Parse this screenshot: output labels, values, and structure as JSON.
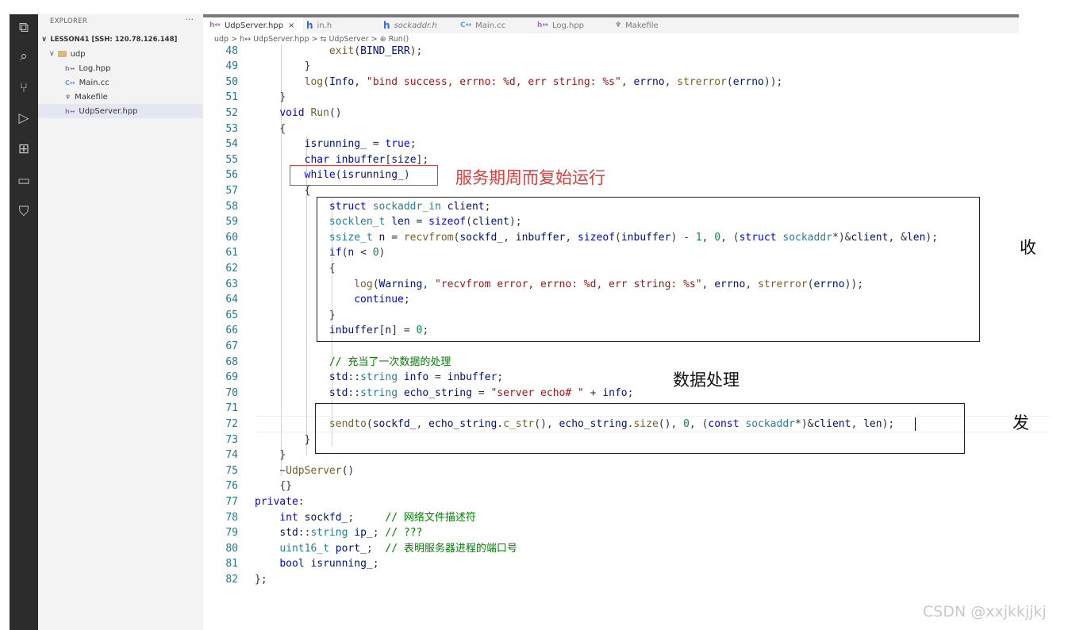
{
  "explorer": {
    "title": "EXPLORER",
    "more": "···",
    "root": "LESSON41 [SSH: 120.78.126.148]",
    "folder": "udp",
    "files": [
      "Log.hpp",
      "Main.cc",
      "Makefile",
      "UdpServer.hpp"
    ]
  },
  "tabs": [
    {
      "icon": "h↔",
      "label": "UdpServer.hpp",
      "close": "×"
    },
    {
      "icon": "h",
      "label": "in.h"
    },
    {
      "icon": "h",
      "label": "sockaddr.h"
    },
    {
      "icon": "C↔",
      "label": "Main.cc"
    },
    {
      "icon": "h↔",
      "label": "Log.hpp"
    },
    {
      "icon": "M",
      "label": "Makefile"
    }
  ],
  "breadcrumb": "udp > h↔ UdpServer.hpp > ⇆ UdpServer > ⊕ Run()",
  "lines": [
    {
      "n": "48",
      "code": "            exit(BIND_ERR);"
    },
    {
      "n": "49",
      "code": "        }"
    },
    {
      "n": "50",
      "code": "        log(Info, \"bind success, errno: %d, err string: %s\", errno, strerror(errno));"
    },
    {
      "n": "51",
      "code": "    }"
    },
    {
      "n": "52",
      "code": "    void Run()"
    },
    {
      "n": "53",
      "code": "    {"
    },
    {
      "n": "54",
      "code": "        isrunning_ = true;"
    },
    {
      "n": "55",
      "code": "        char inbuffer[size];"
    },
    {
      "n": "56",
      "code": "        while(isrunning_)"
    },
    {
      "n": "57",
      "code": "        {"
    },
    {
      "n": "58",
      "code": "            struct sockaddr_in client;"
    },
    {
      "n": "59",
      "code": "            socklen_t len = sizeof(client);"
    },
    {
      "n": "60",
      "code": "            ssize_t n = recvfrom(sockfd_, inbuffer, sizeof(inbuffer) - 1, 0, (struct sockaddr*)&client, &len);"
    },
    {
      "n": "61",
      "code": "            if(n < 0)"
    },
    {
      "n": "62",
      "code": "            {"
    },
    {
      "n": "63",
      "code": "                log(Warning, \"recvfrom error, errno: %d, err string: %s\", errno, strerror(errno));"
    },
    {
      "n": "64",
      "code": "                continue;"
    },
    {
      "n": "65",
      "code": "            }"
    },
    {
      "n": "66",
      "code": "            inbuffer[n] = 0;"
    },
    {
      "n": "67",
      "code": ""
    },
    {
      "n": "68",
      "code": "            // 充当了一次数据的处理"
    },
    {
      "n": "69",
      "code": "            std::string info = inbuffer;"
    },
    {
      "n": "70",
      "code": "            std::string echo_string = \"server echo# \" + info;"
    },
    {
      "n": "71",
      "code": ""
    },
    {
      "n": "72",
      "code": "            sendto(sockfd_, echo_string.c_str(), echo_string.size(), 0, (const sockaddr*)&client, len);"
    },
    {
      "n": "73",
      "code": "        }"
    },
    {
      "n": "74",
      "code": "    }"
    },
    {
      "n": "75",
      "code": "    ~UdpServer()"
    },
    {
      "n": "76",
      "code": "    {}"
    },
    {
      "n": "77",
      "code": "private:"
    },
    {
      "n": "78",
      "code": "    int sockfd_;     // 网络文件描述符"
    },
    {
      "n": "79",
      "code": "    std::string ip_; // ???"
    },
    {
      "n": "80",
      "code": "    uint16_t port_;  // 表明服务器进程的端口号"
    },
    {
      "n": "81",
      "code": "    bool isrunning_;"
    },
    {
      "n": "82",
      "code": "};"
    }
  ],
  "annotations": {
    "loop": "服务期周而复始运行",
    "recv": "收",
    "process": "数据处理",
    "send": "发"
  },
  "watermark": "CSDN @xxjkkjjkj",
  "colors": {
    "keyword": "#0000ff",
    "comment": "#008000",
    "string": "#a31515",
    "function": "#795e26",
    "variable": "#001080",
    "type": "#267f99",
    "number": "#098658",
    "annotation": "#e03c3c"
  }
}
